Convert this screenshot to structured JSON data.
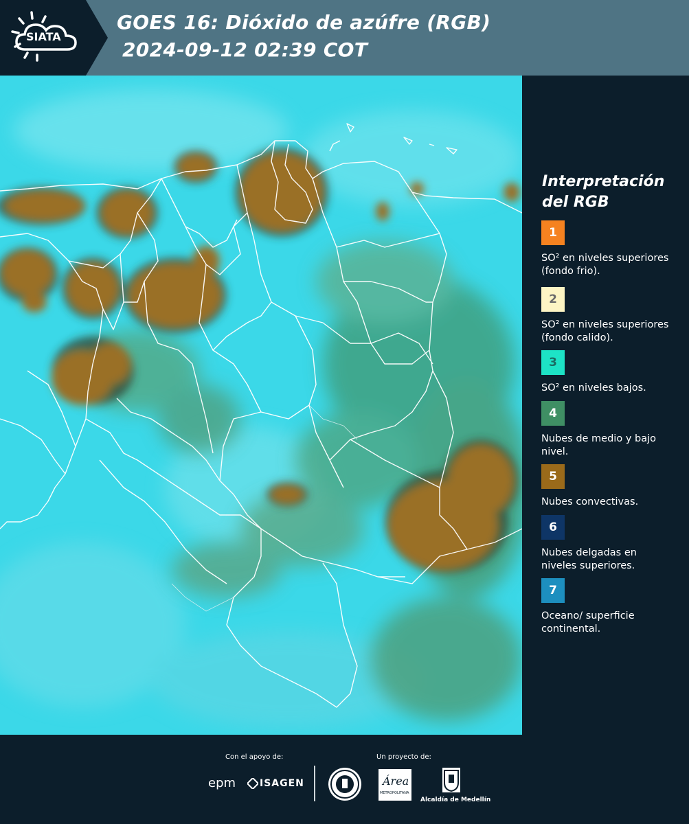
{
  "header": {
    "logo_text": "SIATA",
    "title_line1": "GOES 16: Dióxido de azúfre (RGB)",
    "title_line2": "2024-09-12 02:39 COT"
  },
  "legend": {
    "title": "Interpretación del RGB",
    "items": [
      {
        "number": "1",
        "color": "#f58220",
        "label": "SO² en niveles superiores (fondo frio)."
      },
      {
        "number": "2",
        "color": "#fdf5c4",
        "label": "SO² en niveles superiores (fondo calido)."
      },
      {
        "number": "3",
        "color": "#1de3c6",
        "label": "SO² en niveles bajos."
      },
      {
        "number": "4",
        "color": "#3f8f64",
        "label": "Nubes de medio y bajo nivel."
      },
      {
        "number": "5",
        "color": "#9a6a1a",
        "label": "Nubes convectivas."
      },
      {
        "number": "6",
        "color": "#0e3566",
        "label": "Nubes delgadas en niveles superiores."
      },
      {
        "number": "7",
        "color": "#1d8fbf",
        "label": "Oceano/ superficie continental."
      }
    ]
  },
  "footer": {
    "support_label": "Con el apoyo de:",
    "project_label": "Un proyecto de:",
    "sponsor_epm": "epm",
    "sponsor_isagen": "ISAGEN",
    "area_label": "Área",
    "area_sub": "METROPOLITANA",
    "alcaldia_label": "Alcaldía de Medellín"
  },
  "colors": {
    "background": "#0c1e2b",
    "header_bar": "#4f7484",
    "ocean": "#39d6e6",
    "convective_clouds": "#8f6a1e"
  }
}
